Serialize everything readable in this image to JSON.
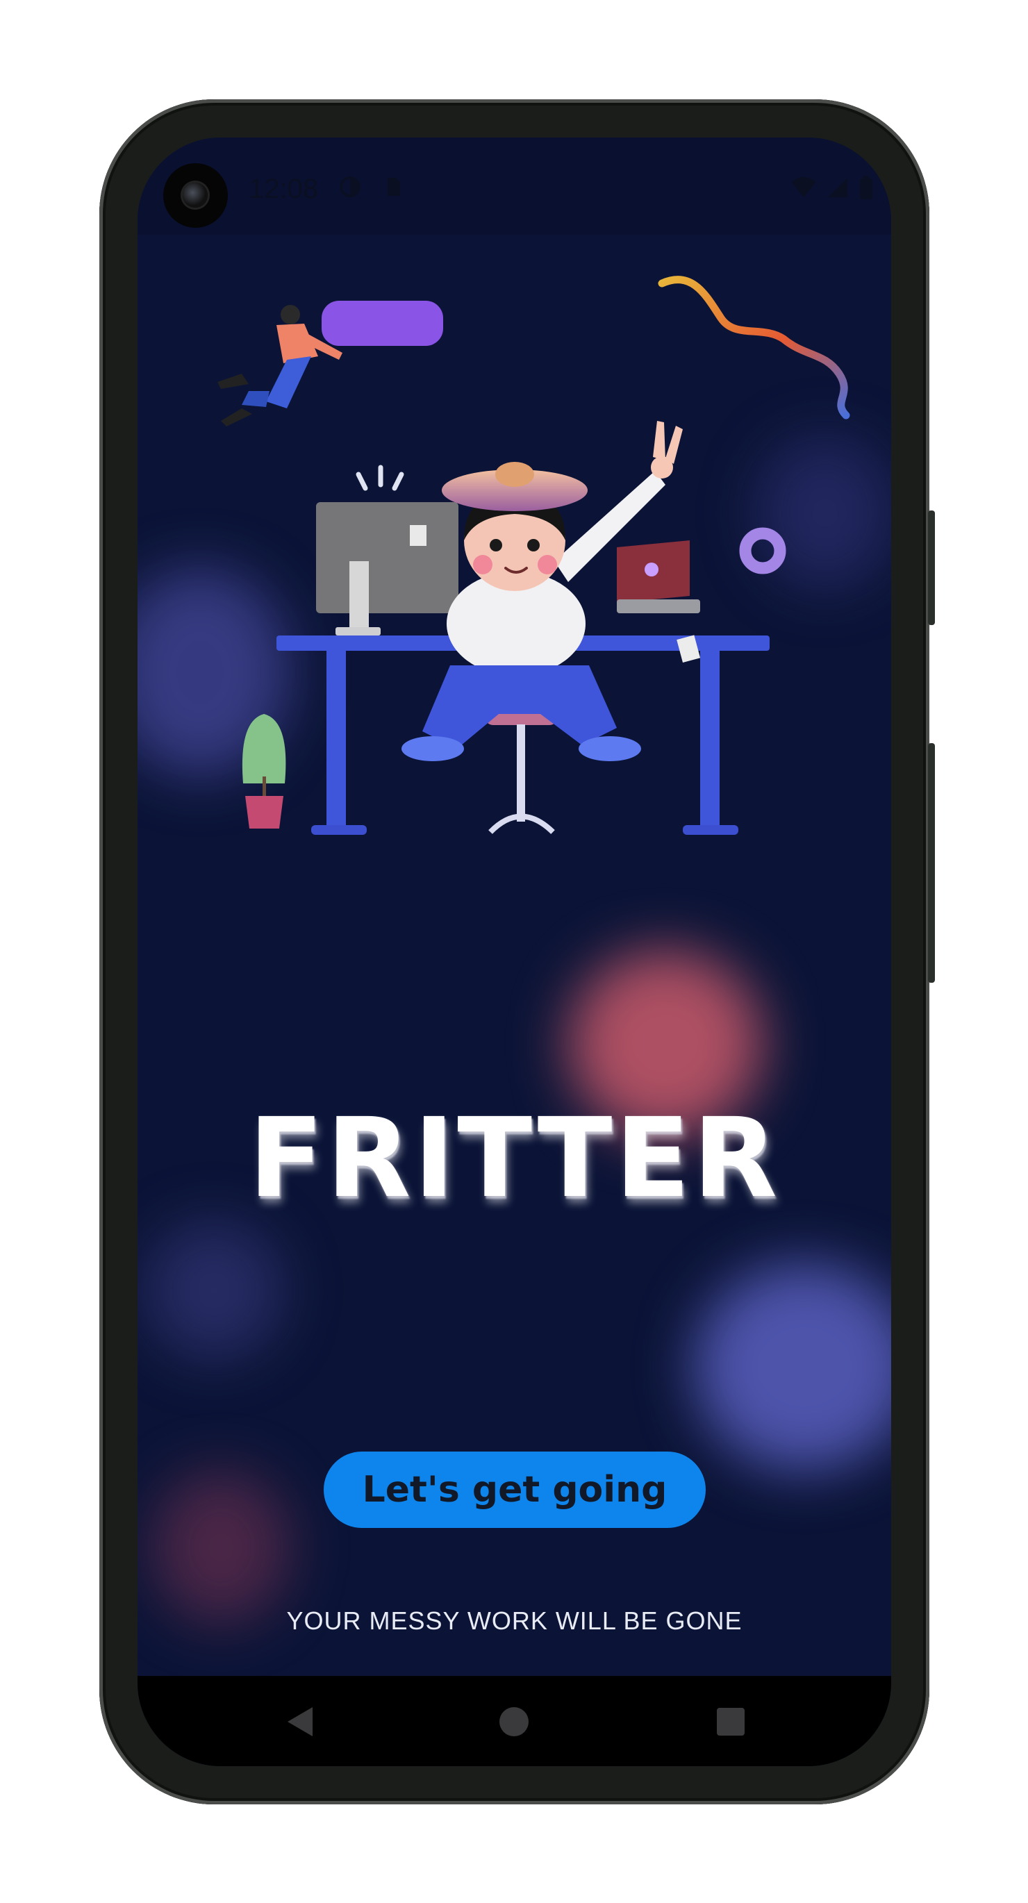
{
  "status_bar": {
    "time": "12:08"
  },
  "app": {
    "title": "FRITTER",
    "cta_label": "Let's get going",
    "tagline": "YOUR MESSY WORK WILL BE GONE"
  },
  "navigation": {
    "back": "back-icon",
    "home": "home-icon",
    "recents": "recents-icon"
  },
  "colors": {
    "background": "#0b1437",
    "cta": "#0e85ec",
    "title": "#ffffff"
  }
}
